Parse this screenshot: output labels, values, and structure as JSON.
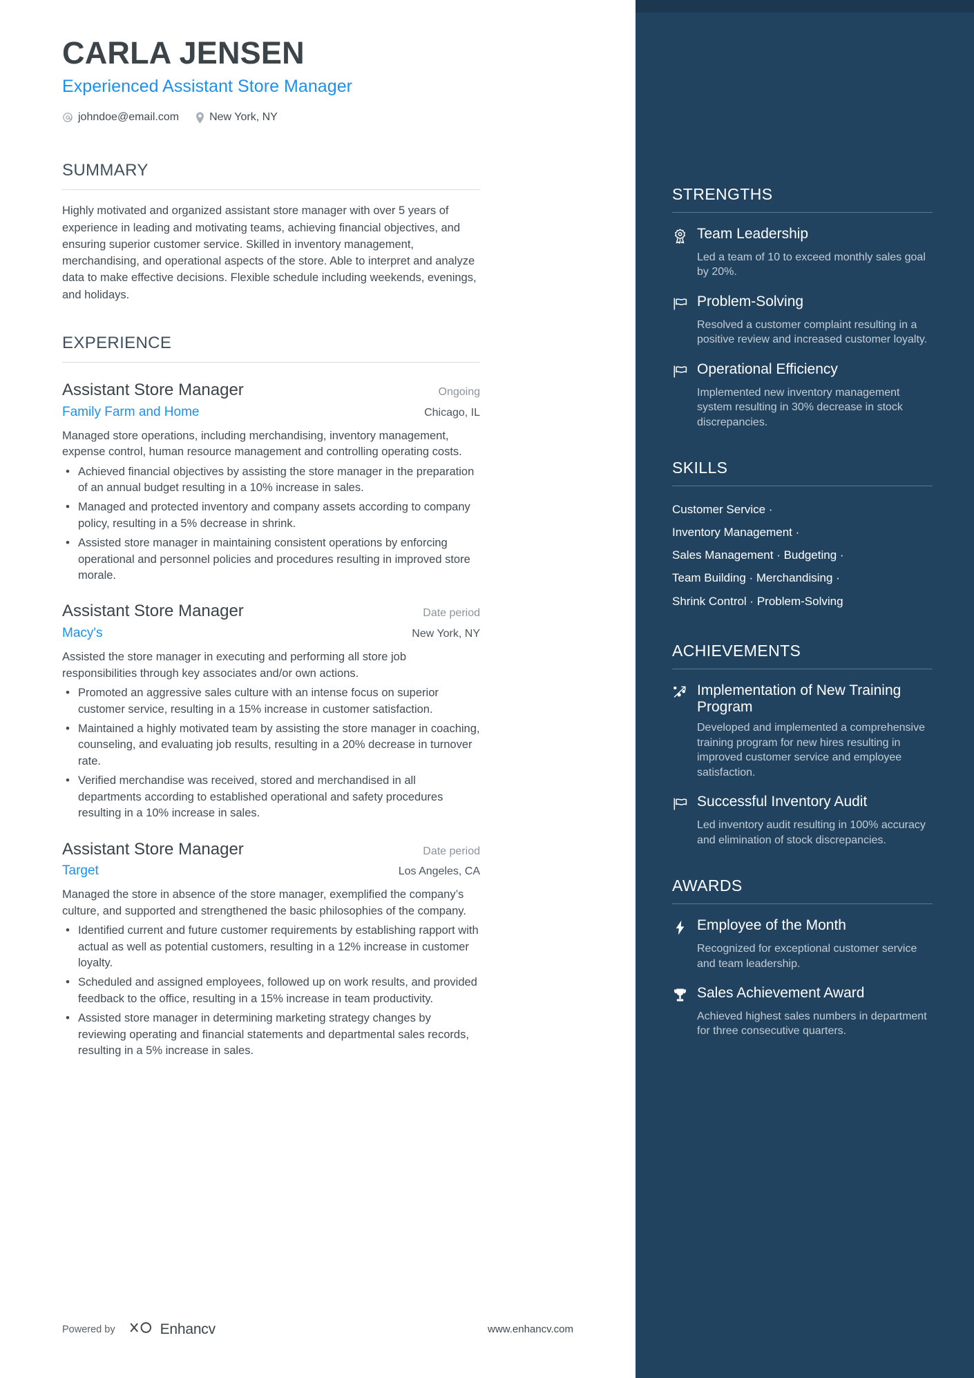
{
  "header": {
    "name": "CARLA JENSEN",
    "title": "Experienced Assistant Store Manager",
    "email": "johndoe@email.com",
    "location": "New York, NY",
    "email_icon": "at-sign-icon",
    "location_icon": "map-pin-icon",
    "accent_color": "#1a91f0",
    "name_color": "#3b4449"
  },
  "summary": {
    "heading": "SUMMARY",
    "text": "Highly motivated and organized assistant store manager with over 5 years of experience in leading and motivating teams, achieving financial objectives, and ensuring superior customer service. Skilled in inventory management, merchandising, and operational aspects of the store. Able to interpret and analyze data to make effective decisions. Flexible schedule including weekends, evenings, and holidays."
  },
  "experience": {
    "heading": "EXPERIENCE",
    "jobs": [
      {
        "title": "Assistant Store Manager",
        "date": "Ongoing",
        "company": "Family Farm and Home",
        "location": "Chicago, IL",
        "description": "Managed store operations, including merchandising, inventory management, expense control, human resource management and controlling operating costs.",
        "bullets": [
          "Achieved financial objectives by assisting the store manager in the preparation of an annual budget resulting in a 10% increase in sales.",
          "Managed and protected inventory and company assets according to company policy, resulting in a 5% decrease in shrink.",
          "Assisted store manager in maintaining consistent operations by enforcing operational and personnel policies and procedures resulting in improved store morale."
        ]
      },
      {
        "title": "Assistant Store Manager",
        "date": "Date period",
        "company": "Macy's",
        "location": "New York, NY",
        "description": "Assisted the store manager in executing and performing all store job responsibilities through key associates and/or own actions.",
        "bullets": [
          "Promoted an aggressive sales culture with an intense focus on superior customer service, resulting in a 15% increase in customer satisfaction.",
          "Maintained a highly motivated team by assisting the store manager in coaching, counseling, and evaluating job results, resulting in a 20% decrease in turnover rate.",
          "Verified merchandise was received, stored and merchandised in all departments according to established operational and safety procedures resulting in a 10% increase in sales."
        ]
      },
      {
        "title": "Assistant Store Manager",
        "date": "Date period",
        "company": "Target",
        "location": "Los Angeles, CA",
        "description": "Managed the store in absence of the store manager, exemplified the company’s culture, and supported and strengthened the basic philosophies of the company.",
        "bullets": [
          "Identified current and future customer requirements by establishing rapport with actual as well as potential customers, resulting in a 12% increase in customer loyalty.",
          "Scheduled and assigned employees, followed up on work results, and provided feedback to the office, resulting in a 15% increase in team productivity.",
          "Assisted store manager in determining marketing strategy changes by reviewing operating and financial statements and departmental sales records, resulting in a 5% increase in sales."
        ]
      }
    ]
  },
  "footer": {
    "powered_by": "Powered by",
    "brand": "Enhancv",
    "brand_icon": "enhancv-logo-icon",
    "website": "www.enhancv.com"
  },
  "sidebar": {
    "background_color": "#21435f",
    "strengths": {
      "heading": "STRENGTHS",
      "items": [
        {
          "icon": "award-ribbon-icon",
          "title": "Team Leadership",
          "desc": "Led a team of 10 to exceed monthly sales goal by 20%."
        },
        {
          "icon": "flag-icon",
          "title": "Problem-Solving",
          "desc": "Resolved a customer complaint resulting in a positive review and increased customer loyalty."
        },
        {
          "icon": "flag-icon",
          "title": "Operational Efficiency",
          "desc": "Implemented new inventory management system resulting in 30% decrease in stock discrepancies."
        }
      ]
    },
    "skills": {
      "heading": "SKILLS",
      "lines": [
        "Customer Service ·",
        "Inventory Management ·",
        "Sales Management · Budgeting ·",
        "Team Building · Merchandising ·",
        "Shrink Control · Problem-Solving"
      ]
    },
    "achievements": {
      "heading": "ACHIEVEMENTS",
      "items": [
        {
          "icon": "scatter-trend-icon",
          "title": "Implementation of New Training Program",
          "desc": "Developed and implemented a comprehensive training program for new hires resulting in improved customer service and employee satisfaction."
        },
        {
          "icon": "flag-icon",
          "title": "Successful Inventory Audit",
          "desc": "Led inventory audit resulting in 100% accuracy and elimination of stock discrepancies."
        }
      ]
    },
    "awards": {
      "heading": "AWARDS",
      "items": [
        {
          "icon": "lightning-bolt-icon",
          "title": "Employee of the Month",
          "desc": "Recognized for exceptional customer service and team leadership."
        },
        {
          "icon": "trophy-icon",
          "title": "Sales Achievement Award",
          "desc": "Achieved highest sales numbers in department for three consecutive quarters."
        }
      ]
    }
  }
}
